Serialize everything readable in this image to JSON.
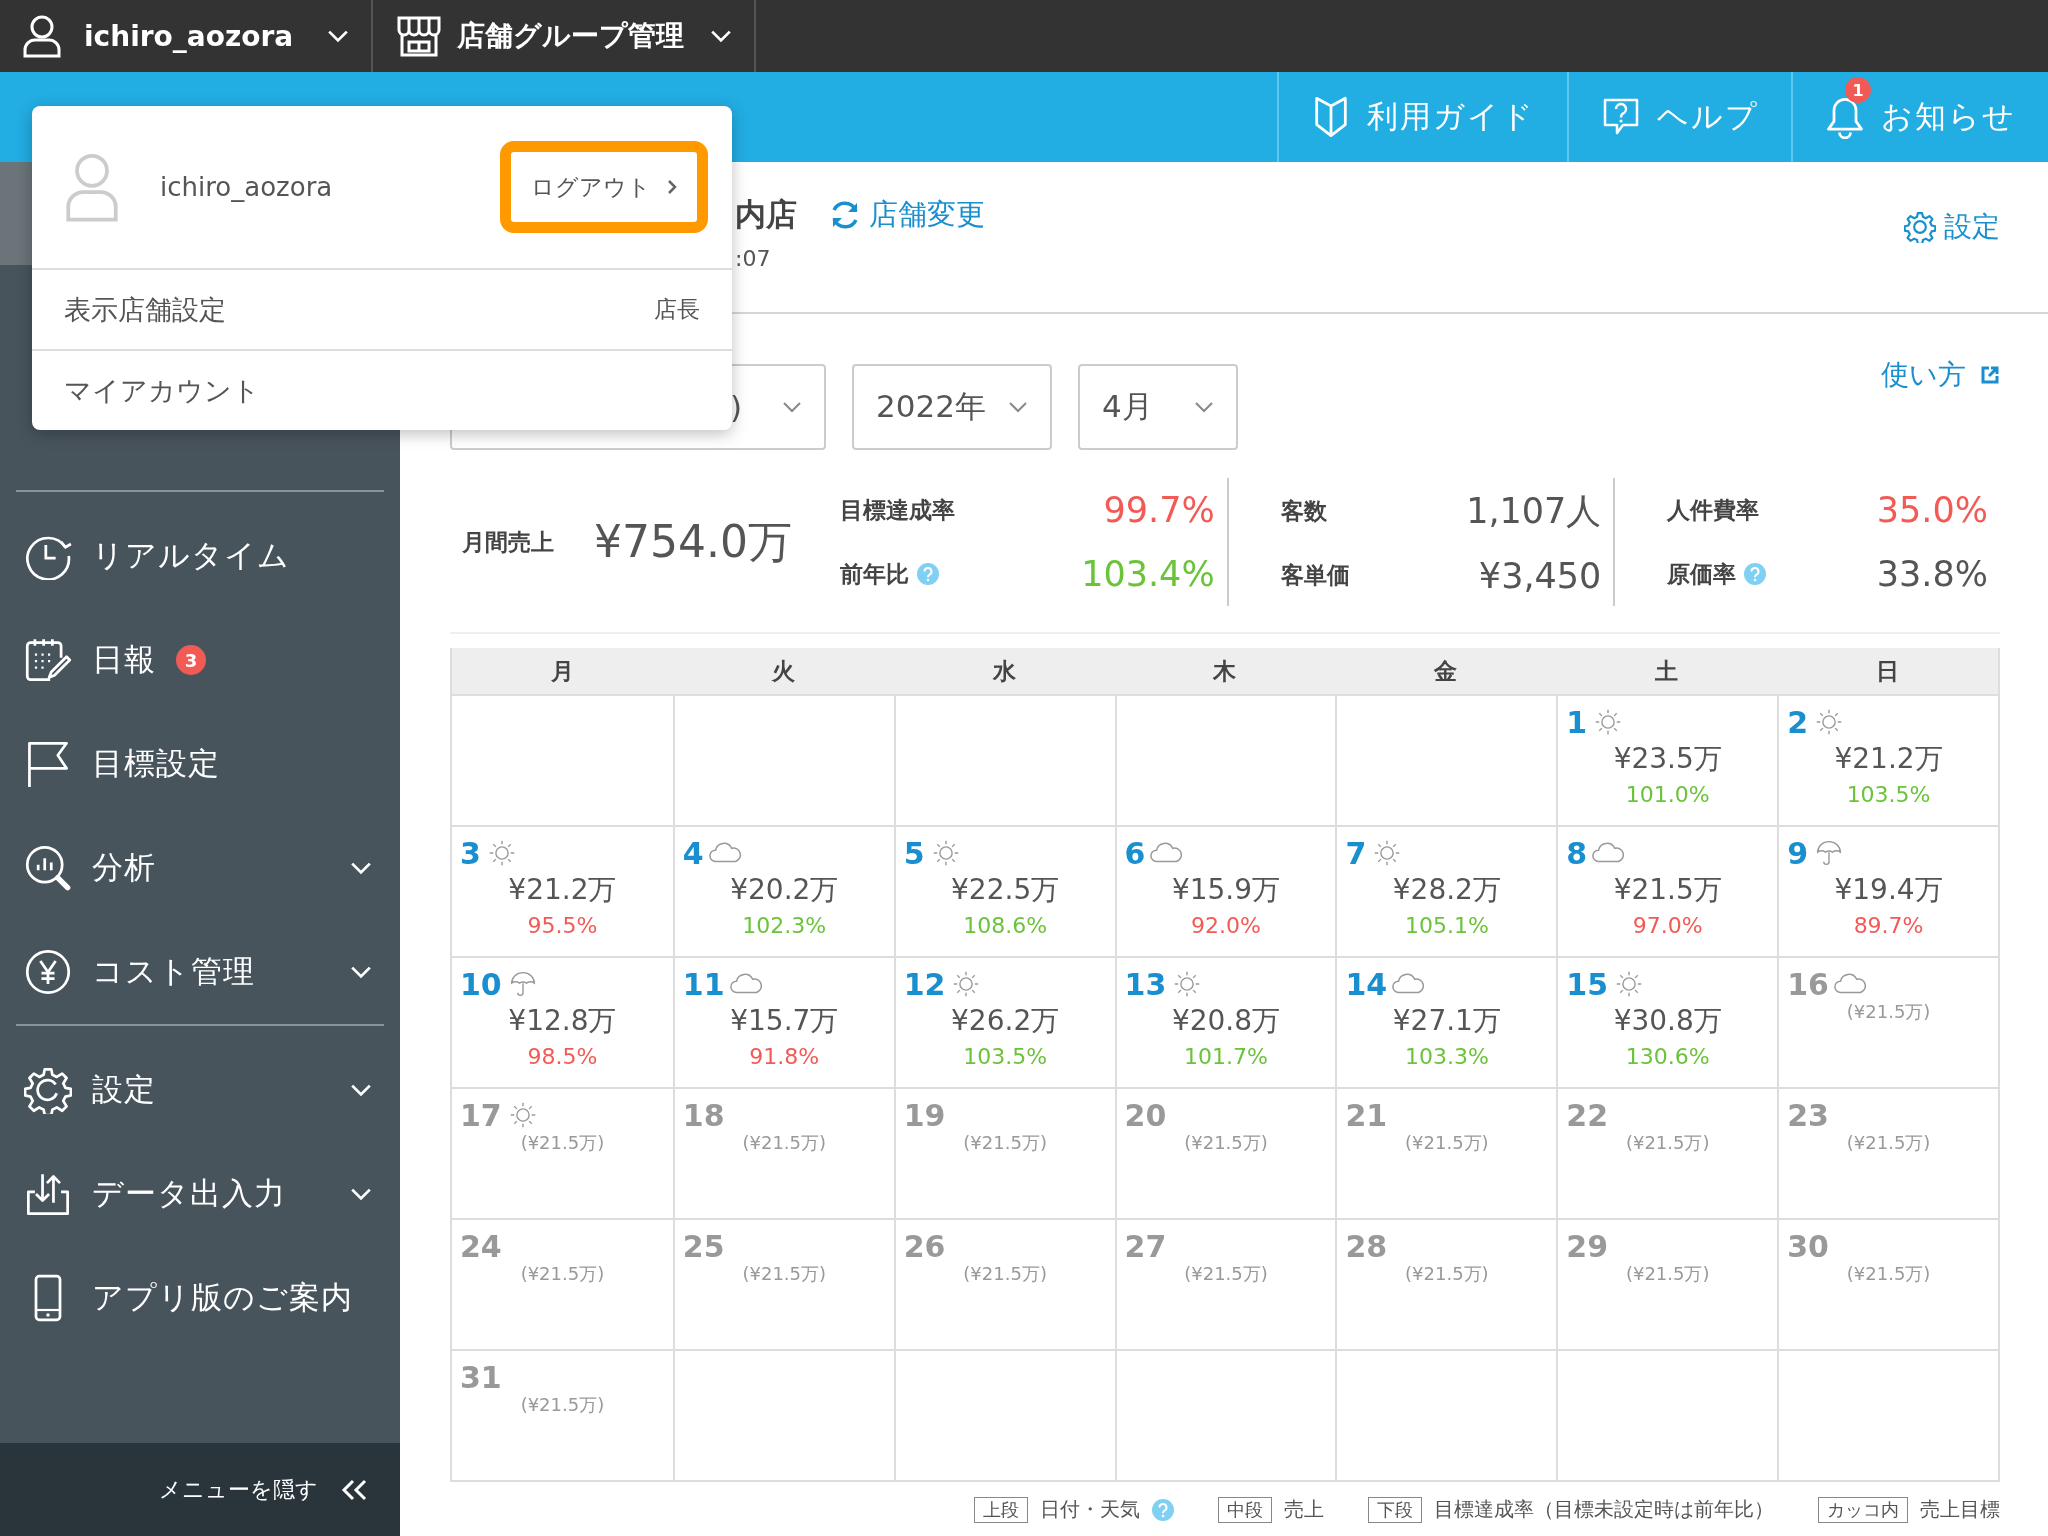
{
  "top_bar": {
    "user": "ichiro_aozora",
    "group": "店舗グループ管理"
  },
  "header_links": [
    {
      "kind": "guide",
      "label": "利用ガイド"
    },
    {
      "kind": "help",
      "label": "ヘルプ"
    },
    {
      "kind": "bell",
      "label": "お知らせ",
      "badge": "1"
    }
  ],
  "sidebar": {
    "groups": [
      [
        {
          "kind": "clock",
          "label": "リアルタイム",
          "expandable": false
        },
        {
          "kind": "calendar",
          "label": "日報",
          "badge": "3",
          "expandable": false
        },
        {
          "kind": "flag",
          "label": "目標設定",
          "expandable": false
        },
        {
          "kind": "analysis",
          "label": "分析",
          "expandable": true
        },
        {
          "kind": "yen",
          "label": "コスト管理",
          "expandable": true
        }
      ],
      [
        {
          "kind": "gear",
          "label": "設定",
          "expandable": true
        },
        {
          "kind": "transfer",
          "label": "データ出入力",
          "expandable": true
        },
        {
          "kind": "phone",
          "label": "アプリ版のご案内",
          "expandable": false
        }
      ]
    ],
    "footer": "メニューを隠す"
  },
  "store": {
    "name": "内店",
    "time": ":07",
    "change_link": "店舗変更",
    "settings_link": "設定"
  },
  "filters": [
    {
      "value": ")"
    },
    {
      "value": "2022年"
    },
    {
      "value": "4月"
    }
  ],
  "help_link": "使い方",
  "summary": {
    "main": {
      "label": "月間売上",
      "value": "¥754.0万"
    },
    "groups": [
      [
        {
          "label": "目標達成率",
          "value": "99.7%",
          "color": "#f25a55",
          "help": false
        },
        {
          "label": "前年比",
          "value": "103.4%",
          "color": "#6bc33a",
          "help": true
        }
      ],
      [
        {
          "label": "客数",
          "value": "1,107人",
          "color": "#555555",
          "help": false
        },
        {
          "label": "客単価",
          "value": "¥3,450",
          "color": "#555555",
          "help": false
        }
      ],
      [
        {
          "label": "人件費率",
          "value": "35.0%",
          "color": "#f25a55",
          "help": false
        },
        {
          "label": "原価率",
          "value": "33.8%",
          "color": "#555555",
          "help": true
        }
      ]
    ]
  },
  "calendar": {
    "weekdays": [
      "月",
      "火",
      "水",
      "木",
      "金",
      "土",
      "日"
    ],
    "weeks": [
      [
        {
          "kind": "empty"
        },
        {
          "kind": "empty"
        },
        {
          "kind": "empty"
        },
        {
          "kind": "empty"
        },
        {
          "kind": "empty"
        },
        {
          "kind": "actual",
          "day": "1",
          "weather": {
            "kind": "sun"
          },
          "sales": "¥23.5万",
          "rate": "101.0%",
          "color": "#6bc33a"
        },
        {
          "kind": "actual",
          "day": "2",
          "weather": {
            "kind": "sun"
          },
          "sales": "¥21.2万",
          "rate": "103.5%",
          "color": "#6bc33a"
        }
      ],
      [
        {
          "kind": "actual",
          "day": "3",
          "weather": {
            "kind": "sun"
          },
          "sales": "¥21.2万",
          "rate": "95.5%",
          "color": "#f25a55"
        },
        {
          "kind": "actual",
          "day": "4",
          "weather": {
            "kind": "cloud"
          },
          "sales": "¥20.2万",
          "rate": "102.3%",
          "color": "#6bc33a"
        },
        {
          "kind": "actual",
          "day": "5",
          "weather": {
            "kind": "sun"
          },
          "sales": "¥22.5万",
          "rate": "108.6%",
          "color": "#6bc33a"
        },
        {
          "kind": "actual",
          "day": "6",
          "weather": {
            "kind": "cloud"
          },
          "sales": "¥15.9万",
          "rate": "92.0%",
          "color": "#f25a55"
        },
        {
          "kind": "actual",
          "day": "7",
          "weather": {
            "kind": "sun"
          },
          "sales": "¥28.2万",
          "rate": "105.1%",
          "color": "#6bc33a"
        },
        {
          "kind": "actual",
          "day": "8",
          "weather": {
            "kind": "cloud"
          },
          "sales": "¥21.5万",
          "rate": "97.0%",
          "color": "#f25a55"
        },
        {
          "kind": "actual",
          "day": "9",
          "weather": {
            "kind": "rain"
          },
          "sales": "¥19.4万",
          "rate": "89.7%",
          "color": "#f25a55"
        }
      ],
      [
        {
          "kind": "actual",
          "day": "10",
          "weather": {
            "kind": "rain"
          },
          "sales": "¥12.8万",
          "rate": "98.5%",
          "color": "#f25a55"
        },
        {
          "kind": "actual",
          "day": "11",
          "weather": {
            "kind": "cloud"
          },
          "sales": "¥15.7万",
          "rate": "91.8%",
          "color": "#f25a55"
        },
        {
          "kind": "actual",
          "day": "12",
          "weather": {
            "kind": "sun"
          },
          "sales": "¥26.2万",
          "rate": "103.5%",
          "color": "#6bc33a"
        },
        {
          "kind": "actual",
          "day": "13",
          "weather": {
            "kind": "sun"
          },
          "sales": "¥20.8万",
          "rate": "101.7%",
          "color": "#6bc33a"
        },
        {
          "kind": "actual",
          "day": "14",
          "weather": {
            "kind": "cloud"
          },
          "sales": "¥27.1万",
          "rate": "103.3%",
          "color": "#6bc33a"
        },
        {
          "kind": "actual",
          "day": "15",
          "weather": {
            "kind": "sun"
          },
          "sales": "¥30.8万",
          "rate": "130.6%",
          "color": "#6bc33a"
        },
        {
          "kind": "plan",
          "day": "16",
          "weather": {
            "kind": "cloud"
          },
          "target": "(¥21.5万)"
        }
      ],
      [
        {
          "kind": "plan",
          "day": "17",
          "weather": {
            "kind": "sun"
          },
          "target": "(¥21.5万)"
        },
        {
          "kind": "plan",
          "day": "18",
          "target": "(¥21.5万)"
        },
        {
          "kind": "plan",
          "day": "19",
          "target": "(¥21.5万)"
        },
        {
          "kind": "plan",
          "day": "20",
          "target": "(¥21.5万)"
        },
        {
          "kind": "plan",
          "day": "21",
          "target": "(¥21.5万)"
        },
        {
          "kind": "plan",
          "day": "22",
          "target": "(¥21.5万)"
        },
        {
          "kind": "plan",
          "day": "23",
          "target": "(¥21.5万)"
        }
      ],
      [
        {
          "kind": "plan",
          "day": "24",
          "target": "(¥21.5万)"
        },
        {
          "kind": "plan",
          "day": "25",
          "target": "(¥21.5万)"
        },
        {
          "kind": "plan",
          "day": "26",
          "target": "(¥21.5万)"
        },
        {
          "kind": "plan",
          "day": "27",
          "target": "(¥21.5万)"
        },
        {
          "kind": "plan",
          "day": "28",
          "target": "(¥21.5万)"
        },
        {
          "kind": "plan",
          "day": "29",
          "target": "(¥21.5万)"
        },
        {
          "kind": "plan",
          "day": "30",
          "target": "(¥21.5万)"
        }
      ],
      [
        {
          "kind": "plan",
          "day": "31",
          "target": "(¥21.5万)"
        },
        {
          "kind": "empty"
        },
        {
          "kind": "empty"
        },
        {
          "kind": "empty"
        },
        {
          "kind": "empty"
        },
        {
          "kind": "empty"
        },
        {
          "kind": "empty"
        }
      ]
    ]
  },
  "legend": [
    {
      "tag": "上段",
      "text": "日付・天気",
      "help": true
    },
    {
      "tag": "中段",
      "text": "売上",
      "help": false
    },
    {
      "tag": "下段",
      "text": "目標達成率（目標未設定時は前年比）",
      "help": false
    },
    {
      "tag": "カッコ内",
      "text": "売上目標",
      "help": false
    }
  ],
  "user_menu": {
    "username": "ichiro_aozora",
    "logout": "ログアウト",
    "rows": [
      {
        "label": "表示店舗設定",
        "value": "店長"
      },
      {
        "label": "マイアカウント"
      }
    ]
  }
}
